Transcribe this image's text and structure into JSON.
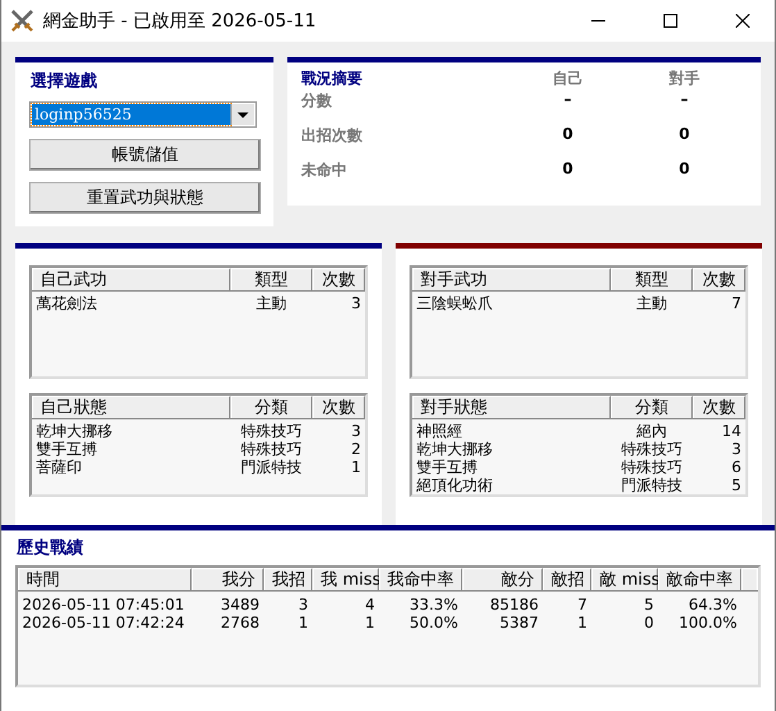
{
  "window": {
    "title": "網金助手 - 已啟用至 2026-05-11"
  },
  "controls": {
    "label": "選擇遊戲",
    "account": "loginp56525",
    "buttons": [
      "帳號儲值",
      "重置武功與狀態"
    ]
  },
  "summary": {
    "title": "戰況摘要",
    "columns": [
      "自己",
      "對手"
    ],
    "rows": [
      {
        "label": "分數",
        "self": "–",
        "opponent": "–"
      },
      {
        "label": "出招次數",
        "self": "0",
        "opponent": "0"
      },
      {
        "label": "未命中",
        "self": "0",
        "opponent": "0"
      }
    ]
  },
  "panels": [
    {
      "color": "#000080",
      "tables": [
        {
          "columns": [
            "自己武功",
            "類型",
            "次數"
          ],
          "rows": [
            [
              "萬花劍法",
              "主動",
              "3"
            ]
          ]
        },
        {
          "columns": [
            "自己狀態",
            "分類",
            "次數"
          ],
          "rows": [
            [
              "乾坤大挪移",
              "特殊技巧",
              "3"
            ],
            [
              "雙手互搏",
              "特殊技巧",
              "2"
            ],
            [
              "菩薩印",
              "門派特技",
              "1"
            ]
          ]
        }
      ]
    },
    {
      "color": "#800000",
      "tables": [
        {
          "columns": [
            "對手武功",
            "類型",
            "次數"
          ],
          "rows": [
            [
              "三陰蜈蚣爪",
              "主動",
              "7"
            ]
          ]
        },
        {
          "columns": [
            "對手狀態",
            "分類",
            "次數"
          ],
          "rows": [
            [
              "神照經",
              "絕內",
              "14"
            ],
            [
              "乾坤大挪移",
              "特殊技巧",
              "3"
            ],
            [
              "雙手互搏",
              "特殊技巧",
              "6"
            ],
            [
              "絕頂化功術",
              "門派特技",
              "5"
            ]
          ]
        }
      ]
    }
  ],
  "history": {
    "title": "歷史戰績",
    "columns": [
      "時間",
      "我分",
      "我招",
      "我 miss",
      "我命中率",
      "敵分",
      "敵招",
      "敵 miss",
      "敵命中率"
    ],
    "rows": [
      [
        "2026-05-11 07:45:01",
        "3489",
        "3",
        "4",
        "33.3%",
        "85186",
        "7",
        "5",
        "64.3%"
      ],
      [
        "2026-05-11 07:42:24",
        "2768",
        "1",
        "1",
        "50.0%",
        "5387",
        "1",
        "0",
        "100.0%"
      ]
    ]
  }
}
